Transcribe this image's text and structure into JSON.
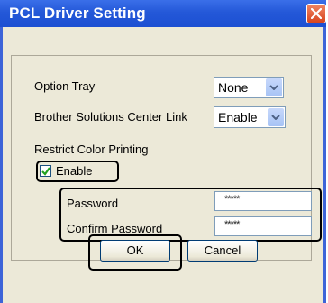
{
  "window": {
    "title": "PCL Driver Setting"
  },
  "option_tray": {
    "label": "Option Tray",
    "value": "None"
  },
  "bscl": {
    "label": "Brother Solutions Center Link",
    "value": "Enable"
  },
  "restrict_color": {
    "label": "Restrict Color Printing",
    "enable_label": "Enable",
    "enable_checked": true
  },
  "password": {
    "label": "Password",
    "value": "*****"
  },
  "confirm_password": {
    "label": "Confirm Password",
    "value": "*****"
  },
  "buttons": {
    "ok": "OK",
    "cancel": "Cancel"
  },
  "colors": {
    "title_bar": "#2458d8",
    "dialog_bg": "#ece9d8",
    "highlight_outline": "#000000"
  },
  "icons": {
    "close": "close-icon",
    "dropdown": "chevron-down-icon",
    "check": "check-icon"
  }
}
